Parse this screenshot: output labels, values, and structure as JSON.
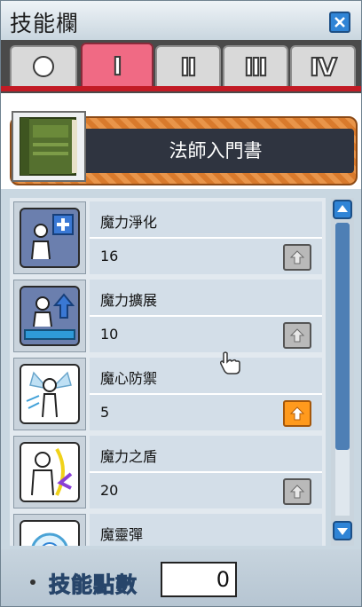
{
  "window": {
    "title": "技能欄",
    "close_icon": "close-icon"
  },
  "tabs": [
    {
      "label": "○",
      "active": false
    },
    {
      "label": "Ⅰ",
      "active": true
    },
    {
      "label": "Ⅱ",
      "active": false
    },
    {
      "label": "Ⅲ",
      "active": false
    },
    {
      "label": "Ⅳ",
      "active": false
    }
  ],
  "book": {
    "title": "法師入門書",
    "icon": "green-book-icon"
  },
  "skills": [
    {
      "name": "魔力淨化",
      "level": "16",
      "can_upgrade": false,
      "icon": "magic-cleanse-icon"
    },
    {
      "name": "魔力擴展",
      "level": "10",
      "can_upgrade": false,
      "icon": "magic-expand-icon"
    },
    {
      "name": "魔心防禦",
      "level": "5",
      "can_upgrade": true,
      "icon": "magic-guard-icon"
    },
    {
      "name": "魔力之盾",
      "level": "20",
      "can_upgrade": false,
      "icon": "magic-shield-icon"
    },
    {
      "name": "魔靈彈",
      "level": "",
      "can_upgrade": false,
      "icon": "magic-bolt-icon"
    }
  ],
  "footer": {
    "label": "技能點數",
    "points": "0"
  },
  "colors": {
    "active_tab": "#f06a84",
    "upgrade_on": "#ff9a1d",
    "accent_blue": "#2f84d6"
  }
}
